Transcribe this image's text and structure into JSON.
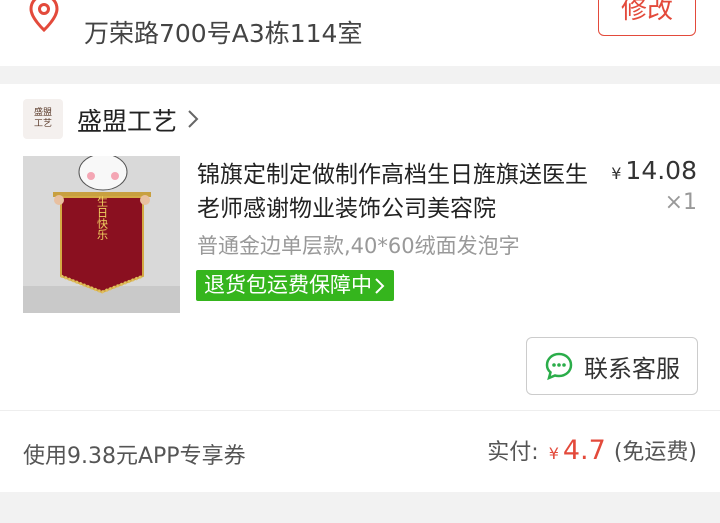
{
  "address": {
    "line2": "万荣路700号A3栋114室",
    "edit_label": "修改"
  },
  "shop": {
    "name": "盛盟工艺",
    "logo_text": [
      "盛盟",
      "工艺"
    ]
  },
  "item": {
    "title": "锦旗定制定做制作高档生日旌旗送医生老师感谢物业装饰公司美容院",
    "price_symbol": "¥",
    "price": "14.08",
    "qty": "×1",
    "spec": "普通金边单层款,40*60绒面发泡字",
    "guarantee": "退货包运费保障中",
    "image_banner_text": "生日快乐"
  },
  "contact_label": "联系客服",
  "footer": {
    "coupon": "使用9.38元APP专享券",
    "paid_label": "实付:",
    "paid_symbol": "¥",
    "paid_amount": "4.7",
    "shipping_note": "(免运费)"
  },
  "colors": {
    "accent": "#e34a3b",
    "guarantee_green": "#35b51d",
    "contact_icon_green": "#2bad4a"
  }
}
